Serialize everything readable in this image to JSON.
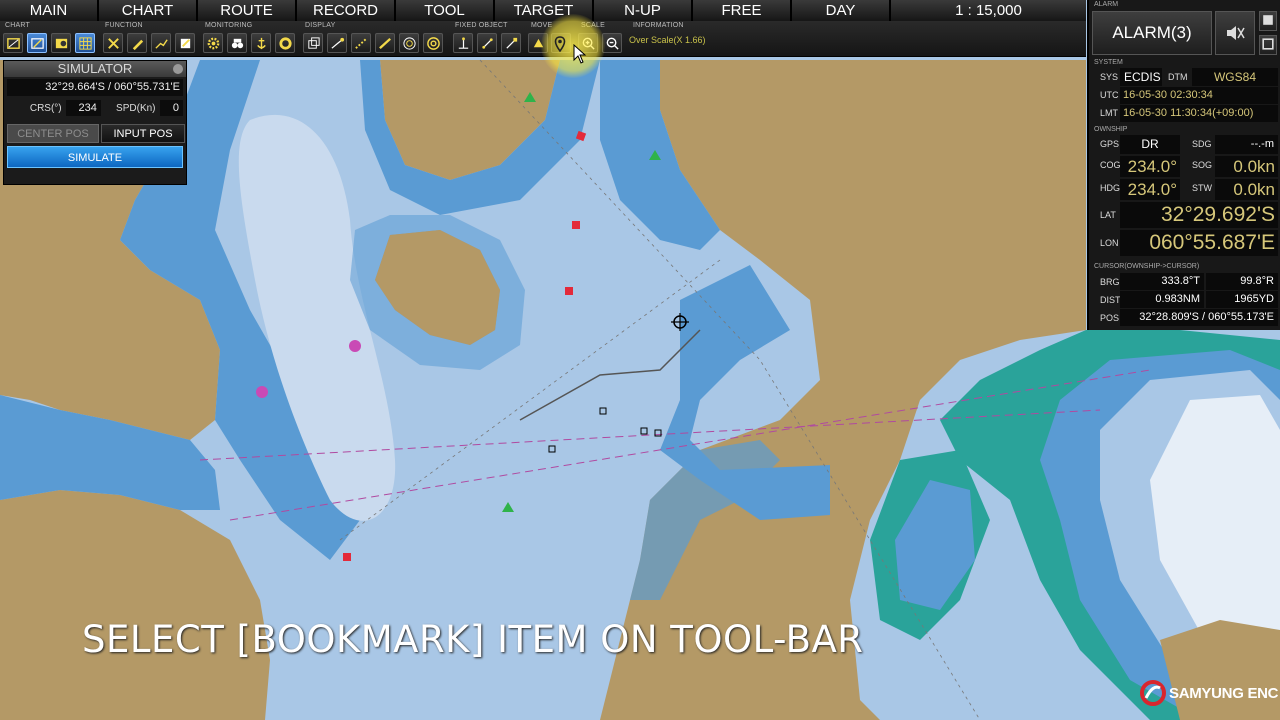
{
  "menu": [
    "MAIN",
    "CHART",
    "ROUTE",
    "RECORD",
    "TOOL",
    "TARGET",
    "N-UP",
    "FREE",
    "DAY"
  ],
  "scale_display": "1 : 15,000",
  "toolbar": {
    "groups": [
      "CHART",
      "FUNCTION",
      "MONITORING",
      "DISPLAY",
      "FIXED OBJECT",
      "MOVE",
      "SCALE",
      "INFORMATION"
    ],
    "scale_info": "Over Scale(X 1.66)",
    "highlighted_button": "bookmark-icon"
  },
  "simulator": {
    "title": "SIMULATOR",
    "position": "32°29.664'S / 060°55.731'E",
    "crs_label": "CRS(°)",
    "crs_value": "234",
    "spd_label": "SPD(Kn)",
    "spd_value": "0",
    "center_pos": "CENTER POS",
    "input_pos": "INPUT POS",
    "simulate": "SIMULATE"
  },
  "alarm": {
    "section": "ALARM",
    "label": "ALARM(3)"
  },
  "system": {
    "section": "SYSTEM",
    "sys_label": "SYS",
    "sys_value": "ECDIS",
    "dtm_label": "DTM",
    "dtm_value": "WGS84",
    "utc_label": "UTC",
    "utc_value": "16-05-30 02:30:34",
    "lmt_label": "LMT",
    "lmt_value": "16-05-30 11:30:34(+09:00)"
  },
  "ownship": {
    "section": "OWNSHIP",
    "gps_label": "GPS",
    "gps_value": "DR",
    "sdg_label": "SDG",
    "sdg_value": "--.-m",
    "cog_label": "COG",
    "cog_value": "234.0°",
    "sog_label": "SOG",
    "sog_value": "0.0kn",
    "hdg_label": "HDG",
    "hdg_value": "234.0°",
    "stw_label": "STW",
    "stw_value": "0.0kn",
    "lat_label": "LAT",
    "lat_value": "32°29.692'S",
    "lon_label": "LON",
    "lon_value": "060°55.687'E"
  },
  "cursor_info": {
    "section": "CURSOR(OWNSHIP->CURSOR)",
    "brg_label": "BRG",
    "brg_true": "333.8°T",
    "brg_rel": "99.8°R",
    "dist_label": "DIST",
    "dist_nm": "0.983NM",
    "dist_yd": "1965YD",
    "pos_label": "POS",
    "pos_value": "32°28.809'S / 060°55.173'E"
  },
  "subtitle": "SELECT [BOOKMARK] ITEM ON TOOL-BAR",
  "logo": "SAMYUNG ENC",
  "colors": {
    "land": "#b49966",
    "shallow": "#5a9bd3",
    "deep": "#a9c7e6",
    "highlight": "#ffe64a",
    "accent": "#1c72cf"
  }
}
